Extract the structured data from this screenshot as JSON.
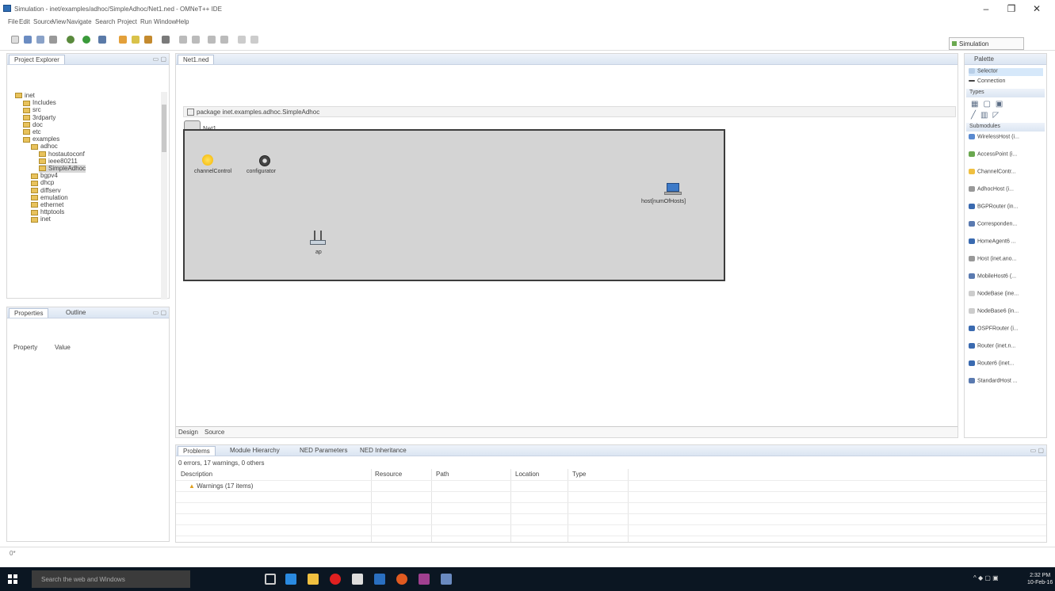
{
  "window": {
    "title": "Simulation - inet/examples/adhoc/SimpleAdhoc/Net1.ned - OMNeT++ IDE",
    "controls": [
      "–",
      "❐",
      "✕"
    ]
  },
  "menu": [
    "File",
    "Edit",
    "Source",
    "View",
    "Navigate",
    "Search",
    "Project",
    "Run",
    "Window",
    "Help"
  ],
  "perspective": "Simulation",
  "project_explorer": {
    "tab": "Project Explorer",
    "tree": [
      {
        "label": "inet",
        "level": 0
      },
      {
        "label": "Includes",
        "level": 1
      },
      {
        "label": "src",
        "level": 1
      },
      {
        "label": "3rdparty",
        "level": 1
      },
      {
        "label": "doc",
        "level": 1
      },
      {
        "label": "etc",
        "level": 1
      },
      {
        "label": "examples",
        "level": 1
      },
      {
        "label": "adhoc",
        "level": 2
      },
      {
        "label": "hostautoconf",
        "level": 3
      },
      {
        "label": "ieee80211",
        "level": 3
      },
      {
        "label": "SimpleAdhoc",
        "level": 3,
        "selected": true
      },
      {
        "label": "bgpv4",
        "level": 2
      },
      {
        "label": "dhcp",
        "level": 2
      },
      {
        "label": "diffserv",
        "level": 2
      },
      {
        "label": "emulation",
        "level": 2
      },
      {
        "label": "ethernet",
        "level": 2
      },
      {
        "label": "httptools",
        "level": 2
      },
      {
        "label": "inet",
        "level": 2
      }
    ]
  },
  "properties": {
    "tabs": [
      "Properties",
      "Outline"
    ],
    "columns": [
      "Property",
      "Value"
    ]
  },
  "editor": {
    "tab": "Net1.ned",
    "package_line": "package inet.examples.adhoc.SimpleAdhoc",
    "network_name": "Net1",
    "nodes": {
      "channel_control": "channelControl",
      "configurator": "configurator",
      "host": "host[numOfHosts]",
      "ap": "ap"
    },
    "footer_tabs": [
      "Design",
      "Source"
    ]
  },
  "palette": {
    "title": "Palette",
    "tools": [
      "Selector",
      "Connection"
    ],
    "sections": [
      "Types",
      "Submodules"
    ],
    "submodules": [
      "WirelessHost (i...",
      "AccessPoint (i...",
      "ChannelContr...",
      "AdhocHost (i...",
      "BGPRouter (in...",
      "Corresponden...",
      "HomeAgent6 ...",
      "Host (inet.ano...",
      "MobileHost6 (...",
      "NodeBase (ine...",
      "NodeBase6 (in...",
      "OSPFRouter (i...",
      "Router (inet.n...",
      "Router6 (inet...",
      "StandardHost ..."
    ]
  },
  "problems": {
    "tabs": [
      "Problems",
      "Module Hierarchy",
      "NED Parameters",
      "NED Inheritance"
    ],
    "summary": "0 errors, 17 warnings, 0 others",
    "columns": [
      "Description",
      "Resource",
      "Path",
      "Location",
      "Type"
    ],
    "rows": [
      "Warnings (17 items)"
    ]
  },
  "statusbar": "0*",
  "taskbar": {
    "search_placeholder": "Search the web and Windows",
    "time": "2:32 PM",
    "date": "10-Feb-16"
  }
}
